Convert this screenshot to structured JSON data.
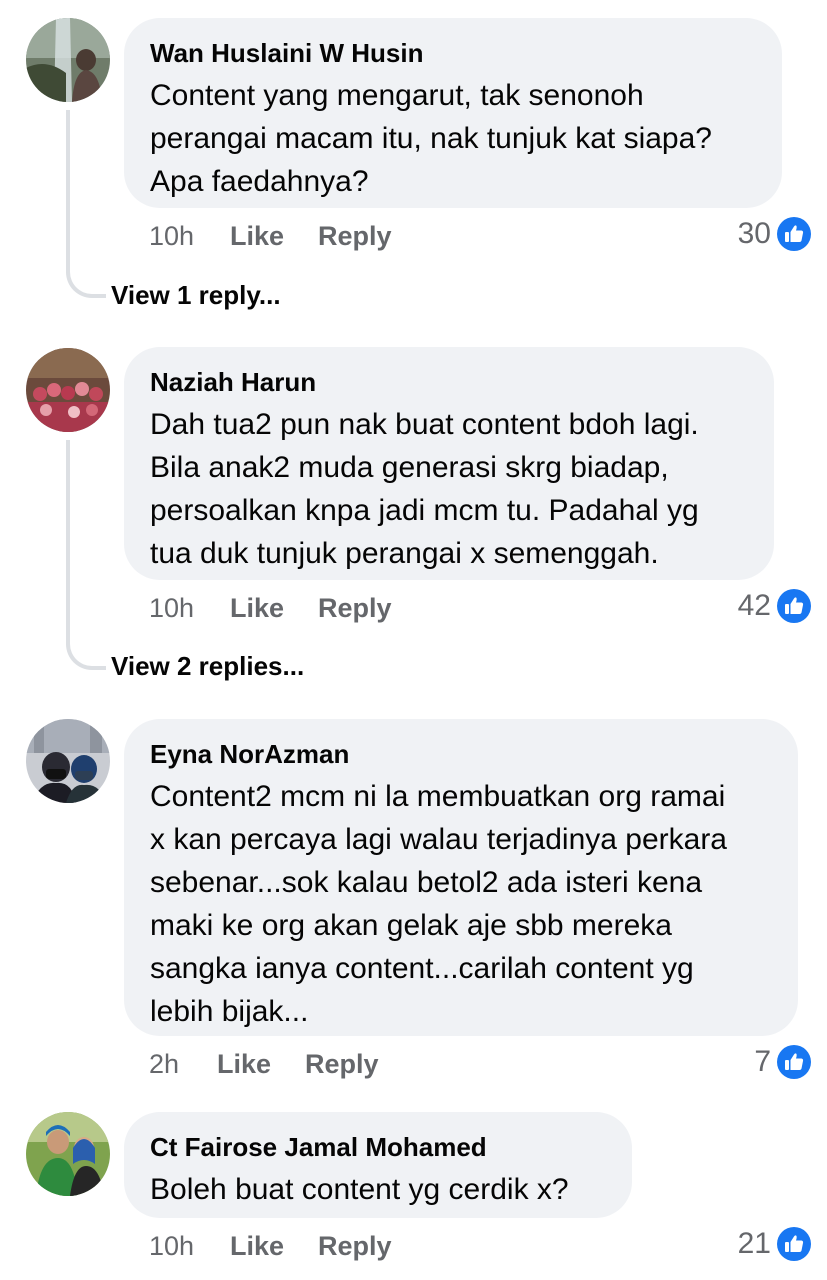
{
  "comments": [
    {
      "author": "Wan Huslaini W Husin",
      "text": "Content yang mengarut, tak senonoh\nperangai macam itu, nak tunjuk kat siapa?\nApa faedahnya?",
      "time": "10h",
      "like_label": "Like",
      "reply_label": "Reply",
      "reaction_count": "30",
      "reaction_icon": "like-reaction-icon",
      "view_replies": "View 1 reply..."
    },
    {
      "author": "Naziah Harun",
      "text": "Dah tua2 pun nak buat content bdoh lagi.\nBila anak2 muda generasi skrg biadap,\npersoalkan knpa jadi mcm tu. Padahal yg\ntua duk tunjuk perangai x semenggah.",
      "time": "10h",
      "like_label": "Like",
      "reply_label": "Reply",
      "reaction_count": "42",
      "reaction_icon": "like-reaction-icon",
      "view_replies": "View 2 replies..."
    },
    {
      "author": "Eyna NorAzman",
      "text": "Content2 mcm ni la membuatkan org ramai\nx kan percaya lagi walau terjadinya perkara\nsebenar...sok kalau betol2 ada isteri kena\nmaki ke org akan gelak aje sbb mereka\nsangka ianya content...carilah content yg\nlebih bijak...",
      "time": "2h",
      "like_label": "Like",
      "reply_label": "Reply",
      "reaction_count": "7",
      "reaction_icon": "like-reaction-icon"
    },
    {
      "author": "Ct Fairose Jamal Mohamed",
      "text": "Boleh buat content yg cerdik x?",
      "time": "10h",
      "like_label": "Like",
      "reply_label": "Reply",
      "reaction_count": "21",
      "reaction_icon": "like-reaction-icon"
    }
  ],
  "colors": {
    "bubble_background": "#f0f2f5",
    "secondary_text": "#65676b",
    "like_blue": "#1877f2",
    "thread_line": "#dcdfe3"
  }
}
